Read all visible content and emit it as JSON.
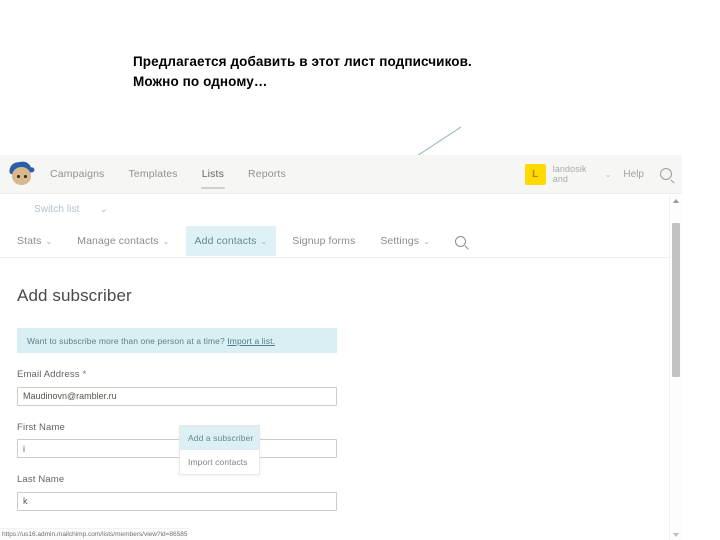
{
  "slide": {
    "caption_line1": "Предлагается добавить в этот лист подписчиков.",
    "caption_line2": "Можно по одному…"
  },
  "browser": {
    "status_url": "https://us16.admin.mailchimp.com/lists/members/view?id=86585"
  },
  "header": {
    "logo_name": "mailchimp-freddie-logo",
    "nav": [
      {
        "label": "Campaigns",
        "active": false
      },
      {
        "label": "Templates",
        "active": false
      },
      {
        "label": "Lists",
        "active": true
      },
      {
        "label": "Reports",
        "active": false
      }
    ],
    "avatar_initial": "L",
    "username_line1": "landosik",
    "username_line2": "and",
    "chevron": "⌄",
    "help_label": "Help",
    "search_icon": "search-icon"
  },
  "switch_list": {
    "label": "Switch list",
    "chevron": "⌄"
  },
  "subnav": {
    "items": [
      {
        "label": "Stats",
        "caret": "⌄",
        "selected": false
      },
      {
        "label": "Manage contacts",
        "caret": "⌄",
        "selected": false
      },
      {
        "label": "Add contacts",
        "caret": "⌄",
        "selected": true
      },
      {
        "label": "Signup forms",
        "caret": "",
        "selected": false
      },
      {
        "label": "Settings",
        "caret": "⌄",
        "selected": false
      }
    ],
    "search_icon": "search-icon"
  },
  "dropdown": {
    "options": [
      {
        "label": "Add a subscriber",
        "highlighted": true
      },
      {
        "label": "Import contacts",
        "highlighted": false
      }
    ]
  },
  "page": {
    "title": "Add subscriber",
    "notice_text": "Want to subscribe more than one person at a time? ",
    "notice_link": "Import a list.",
    "fields": [
      {
        "label": "Email Address",
        "required": "*",
        "value": "Maudinovn@rambler.ru"
      },
      {
        "label": "First Name",
        "required": "",
        "value": "i"
      },
      {
        "label": "Last Name",
        "required": "",
        "value": "k"
      }
    ]
  },
  "colors": {
    "highlight": "#d6eef2",
    "notice_bg": "#d9eff3",
    "avatar_bg": "#ffd900",
    "pointer_line": "#8fb6bd"
  }
}
